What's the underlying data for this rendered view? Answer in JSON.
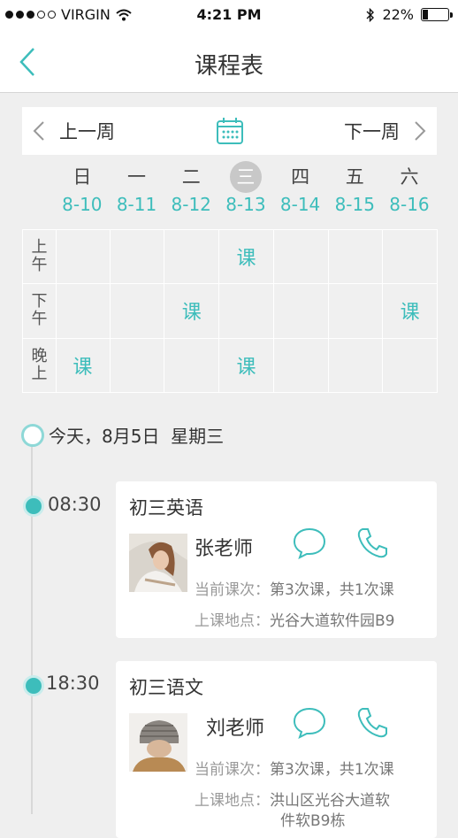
{
  "status": {
    "carrier": "VIRGIN",
    "time": "4:21 PM",
    "battery": "22%"
  },
  "nav": {
    "title": "课程表",
    "back_icon": "chevron-left-icon"
  },
  "week": {
    "prev_label": "上一周",
    "next_label": "下一周",
    "calendar_icon": "calendar-icon"
  },
  "days": [
    {
      "weekday": "日",
      "date": "8-10",
      "today": false
    },
    {
      "weekday": "一",
      "date": "8-11",
      "today": false
    },
    {
      "weekday": "二",
      "date": "8-12",
      "today": false
    },
    {
      "weekday": "三",
      "date": "8-13",
      "today": true
    },
    {
      "weekday": "四",
      "date": "8-14",
      "today": false
    },
    {
      "weekday": "五",
      "date": "8-15",
      "today": false
    },
    {
      "weekday": "六",
      "date": "8-16",
      "today": false
    }
  ],
  "grid": {
    "course_mark": "课",
    "rows": [
      {
        "label": [
          "上",
          "午"
        ],
        "slots": [
          false,
          false,
          false,
          true,
          false,
          false,
          false
        ]
      },
      {
        "label": [
          "下",
          "午"
        ],
        "slots": [
          false,
          false,
          true,
          false,
          false,
          false,
          true
        ]
      },
      {
        "label": [
          "晚",
          "上"
        ],
        "slots": [
          true,
          false,
          false,
          true,
          false,
          false,
          false
        ]
      }
    ]
  },
  "today_text": "今天，8月5日  星期三",
  "accent_color": "#3dbdbb",
  "lessons": [
    {
      "time": "08:30",
      "subject": "初三英语",
      "teacher": "张老师",
      "progress_label": "当前课次：",
      "progress_value": "第3次课，共1次课",
      "location_label": "上课地点：",
      "location_value_line1": "光谷大道软件园B9",
      "location_value_line2": ""
    },
    {
      "time": "18:30",
      "subject": "初三语文",
      "teacher": "刘老师",
      "progress_label": "当前课次：",
      "progress_value": "第3次课，共1次课",
      "location_label": "上课地点：",
      "location_value_line1": "洪山区光谷大道软",
      "location_value_line2": "件软B9栋"
    }
  ]
}
